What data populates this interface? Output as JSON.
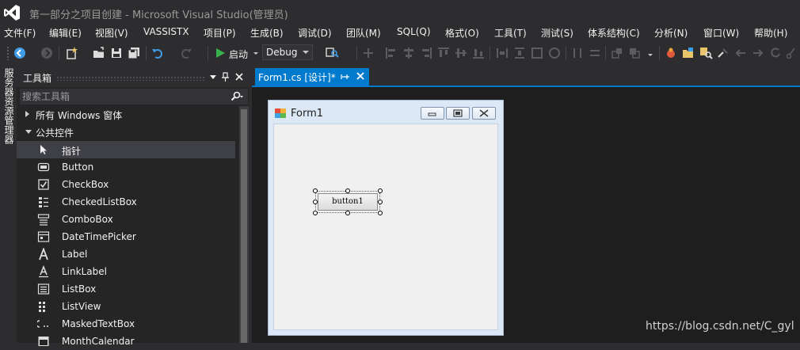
{
  "window": {
    "title": "第一部分之项目创建 - Microsoft Visual Studio(管理员)"
  },
  "menu": [
    "文件(F)",
    "编辑(E)",
    "视图(V)",
    "VASSISTX",
    "项目(P)",
    "生成(B)",
    "调试(D)",
    "团队(M)",
    "SQL(Q)",
    "格式(O)",
    "工具(T)",
    "测试(S)",
    "体系结构(C)",
    "分析(N)",
    "窗口(W)",
    "帮助(H)"
  ],
  "toolbar": {
    "start_label": "启动",
    "configuration": "Debug"
  },
  "left_tab": {
    "label": "服务器资源管理器"
  },
  "toolbox": {
    "title": "工具箱",
    "search_placeholder": "搜索工具箱",
    "groups": [
      {
        "label": "所有 Windows 窗体",
        "expanded": false
      },
      {
        "label": "公共控件",
        "expanded": true
      }
    ],
    "items": [
      {
        "label": "指针",
        "icon": "pointer-icon",
        "selected": true
      },
      {
        "label": "Button",
        "icon": "button-control-icon"
      },
      {
        "label": "CheckBox",
        "icon": "checkbox-icon"
      },
      {
        "label": "CheckedListBox",
        "icon": "checked-listbox-icon"
      },
      {
        "label": "ComboBox",
        "icon": "combobox-icon"
      },
      {
        "label": "DateTimePicker",
        "icon": "datetimepicker-icon"
      },
      {
        "label": "Label",
        "icon": "label-icon"
      },
      {
        "label": "LinkLabel",
        "icon": "linklabel-icon"
      },
      {
        "label": "ListBox",
        "icon": "listbox-icon"
      },
      {
        "label": "ListView",
        "icon": "listview-icon"
      },
      {
        "label": "MaskedTextBox",
        "icon": "maskedtextbox-icon"
      },
      {
        "label": "MonthCalendar",
        "icon": "monthcalendar-icon"
      }
    ]
  },
  "document_tab": {
    "label": "Form1.cs [设计]*"
  },
  "designer": {
    "form_title": "Form1",
    "button_text": "button1"
  },
  "watermark": "https://blog.csdn.net/C_gyl",
  "colors": {
    "accent": "#007acc",
    "background": "#2d2d30",
    "editor": "#1e1e1e",
    "panel": "#252526"
  }
}
